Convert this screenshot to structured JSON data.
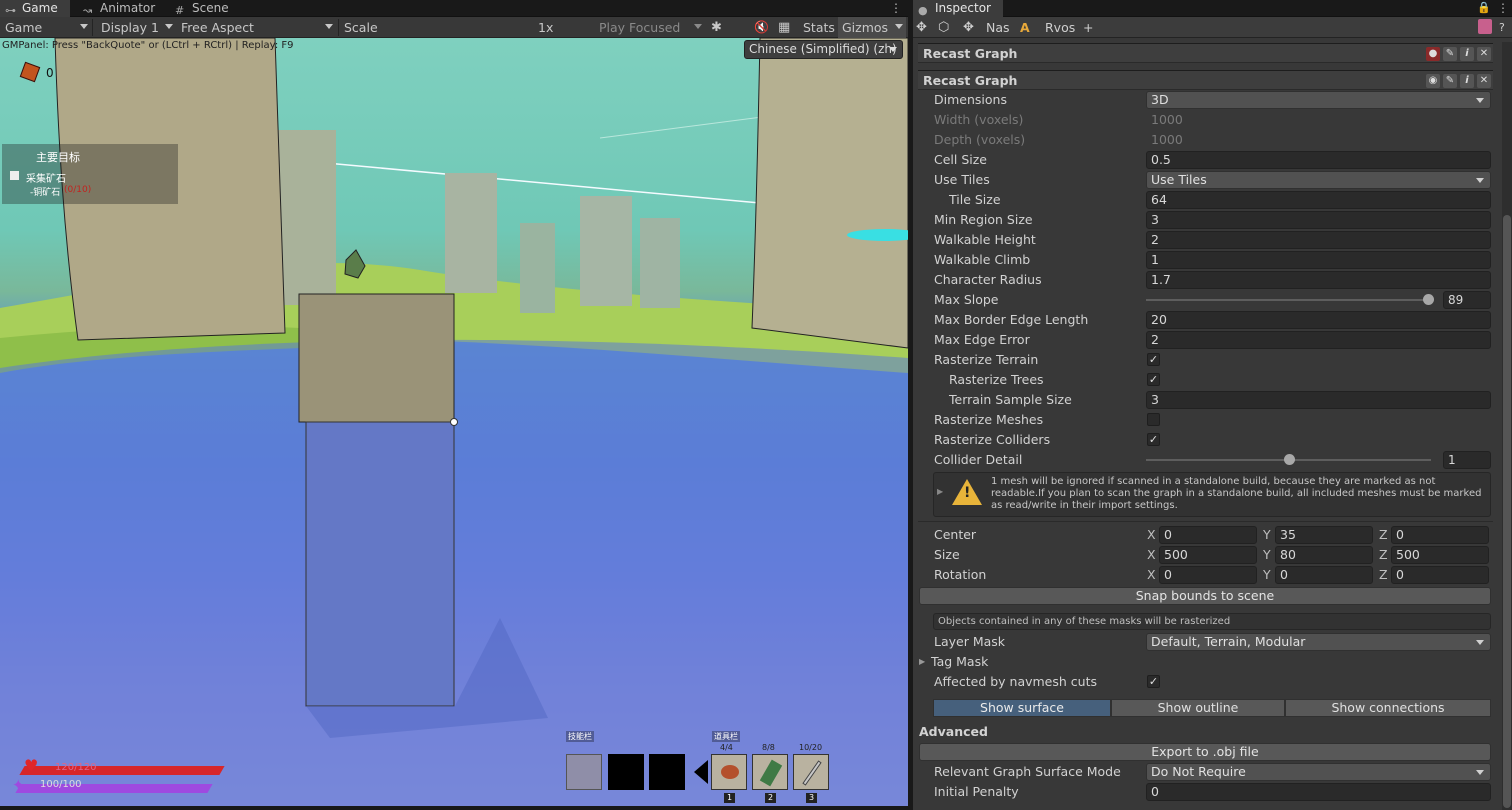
{
  "tabs_left": [
    {
      "label": "Game",
      "icon": "gamepad-icon"
    },
    {
      "label": "Animator",
      "icon": "animator-icon"
    },
    {
      "label": "Scene",
      "icon": "scene-grid-icon"
    }
  ],
  "tabs_right": [
    {
      "label": "Inspector",
      "icon": "info-icon"
    }
  ],
  "game_toolbar": {
    "game_dropdown": "Game",
    "display_dropdown": "Display 1",
    "aspect_dropdown": "Free Aspect",
    "scale_label": "Scale",
    "scale_value": "1x",
    "scale_fraction": 0.0,
    "play_mode": "Play Focused",
    "stats": "Stats",
    "gizmos": "Gizmos"
  },
  "game_view": {
    "gm_panel_text": "GMPanel: Press \"BackQuote\" or (LCtrl + RCtrl) | Replay: F9",
    "language_dropdown": "Chinese (Simplified) (zh)",
    "ore_count": "0",
    "quest_title": "主要目标",
    "quest_item": "采集矿石",
    "quest_sub": "-铜矿石",
    "quest_progress": "(0/10)",
    "skill_bar_label": "技能栏",
    "item_bar_label": "道具栏",
    "items": [
      {
        "count": "4/4",
        "key": "1"
      },
      {
        "count": "8/8",
        "key": "2"
      },
      {
        "count": "10/20",
        "key": "3"
      }
    ],
    "hp_text": "120/120",
    "hp_fraction": 1.0,
    "mp_text": "100/100",
    "mp_fraction": 1.0
  },
  "inspector_toolbar": {
    "tabs": [
      "Nas",
      "Rvos"
    ],
    "add": "+"
  },
  "component_header": "Recast Graph",
  "graph_header": "Recast Graph",
  "properties": [
    {
      "label": "Dimensions",
      "type": "dropdown",
      "value": "3D"
    },
    {
      "label": "Width (voxels)",
      "type": "disabled",
      "value": "1000"
    },
    {
      "label": "Depth (voxels)",
      "type": "disabled",
      "value": "1000"
    },
    {
      "label": "Cell Size",
      "type": "field",
      "value": "0.5"
    },
    {
      "label": "Use Tiles",
      "type": "dropdown",
      "value": "Use Tiles"
    },
    {
      "label": "Tile Size",
      "type": "field",
      "value": "64",
      "indent": true
    },
    {
      "label": "Min Region Size",
      "type": "field",
      "value": "3"
    },
    {
      "label": "Walkable Height",
      "type": "field",
      "value": "2"
    },
    {
      "label": "Walkable Climb",
      "type": "field",
      "value": "1"
    },
    {
      "label": "Character Radius",
      "type": "field",
      "value": "1.7"
    },
    {
      "label": "Max Slope",
      "type": "slider",
      "value": "89",
      "fraction": 0.989
    },
    {
      "label": "Max Border Edge Length",
      "type": "field",
      "value": "20"
    },
    {
      "label": "Max Edge Error",
      "type": "field",
      "value": "2"
    },
    {
      "label": "Rasterize Terrain",
      "type": "check",
      "value": true
    },
    {
      "label": "Rasterize Trees",
      "type": "check",
      "value": true,
      "indent": true
    },
    {
      "label": "Terrain Sample Size",
      "type": "field",
      "value": "3",
      "indent": true
    },
    {
      "label": "Rasterize Meshes",
      "type": "check",
      "value": false
    },
    {
      "label": "Rasterize Colliders",
      "type": "check",
      "value": true
    },
    {
      "label": "Collider Detail",
      "type": "slider",
      "value": "1",
      "fraction": 0.5
    }
  ],
  "warning_text": "1 mesh will be ignored if scanned in a standalone build, because they are marked as not readable.If you plan to scan the graph in a standalone build, all included meshes must be marked as read/write in their import settings.",
  "bounds": {
    "center": {
      "label": "Center",
      "x": "0",
      "y": "35",
      "z": "0"
    },
    "size": {
      "label": "Size",
      "x": "500",
      "y": "80",
      "z": "500"
    },
    "rotation": {
      "label": "Rotation",
      "x": "0",
      "y": "0",
      "z": "0"
    },
    "axis_labels": [
      "X",
      "Y",
      "Z"
    ]
  },
  "snap_button": "Snap bounds to scene",
  "mask_note": "Objects contained in any of these masks will be rasterized",
  "layer_mask": {
    "label": "Layer Mask",
    "value": "Default, Terrain, Modular"
  },
  "tag_mask": "Tag Mask",
  "navmesh_cuts": {
    "label": "Affected by navmesh cuts",
    "value": true
  },
  "show_buttons": [
    "Show surface",
    "Show outline",
    "Show connections"
  ],
  "advanced": "Advanced",
  "export_button": "Export to .obj file",
  "surface_mode": {
    "label": "Relevant Graph Surface Mode",
    "value": "Do Not Require"
  },
  "initial_penalty": {
    "label": "Initial Penalty",
    "value": "0"
  }
}
